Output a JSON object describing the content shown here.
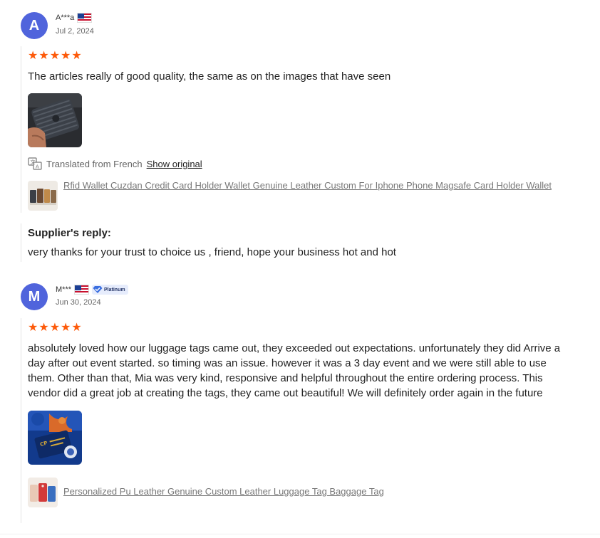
{
  "reviews": [
    {
      "initial": "A",
      "user": "A***a",
      "date": "Jul 2, 2024",
      "rating": 5,
      "text": "The articles really of good quality, the same as on the images that have seen",
      "translated_label": "Translated from French",
      "show_original": "Show original",
      "product_title": "Rfid Wallet Cuzdan Credit Card Holder Wallet Genuine Leather Custom For Iphone Phone Magsafe Card Holder Wallet",
      "supplier_reply_title": "Supplier's reply:",
      "supplier_reply": "very thanks for your trust to choice us , friend, hope your business hot and hot"
    },
    {
      "initial": "M",
      "user": "M***",
      "badge": "Platinum",
      "date": "Jun 30, 2024",
      "rating": 5,
      "text": "absolutely loved how our luggage tags came out, they exceeded out expectations. unfortunately they did Arrive a day after out event started. so timing was an issue. however it was a 3 day event and we were still able to use them. Other than that, Mia was very kind, responsive and helpful throughout the entire ordering process. This vendor did a great job at creating the tags, they came out beautiful! We will definitely order again in the future",
      "product_title": "Personalized Pu Leather Genuine Custom Leather Luggage Tag Baggage Tag"
    }
  ],
  "colors": {
    "avatar": "#5064dc",
    "star": "#fd5a0a",
    "badge_bg": "#e6ecfc"
  },
  "icons": {
    "star": "star-icon",
    "translate": "translate-icon",
    "flag": "us-flag-icon",
    "badge": "diamond-badge-icon"
  }
}
